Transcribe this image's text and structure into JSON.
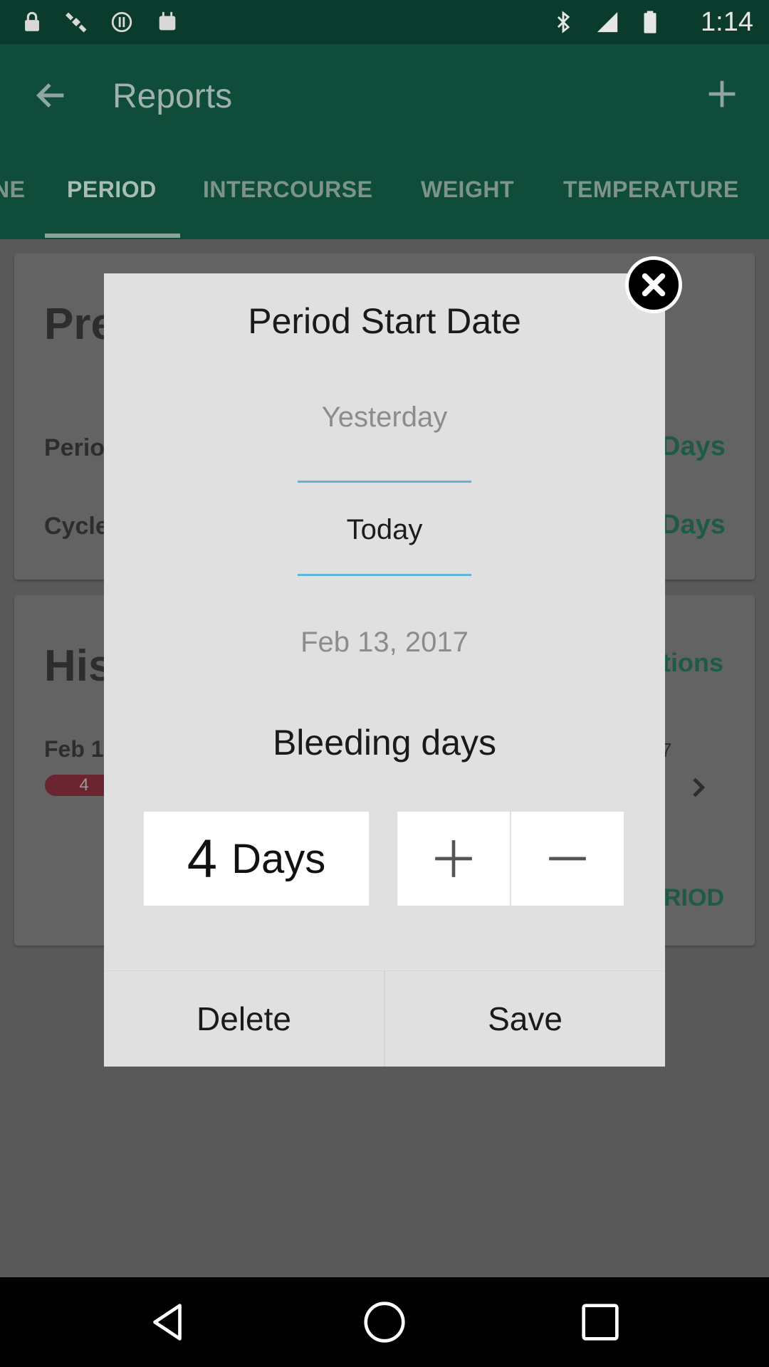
{
  "status_bar": {
    "time": "1:14",
    "icons": [
      "lock-icon",
      "fake-gps-icon",
      "sync-icon",
      "android-icon",
      "bluetooth-icon",
      "signal-icon",
      "battery-icon"
    ]
  },
  "app_bar": {
    "title": "Reports",
    "tabs": [
      {
        "label": "NE",
        "active": false
      },
      {
        "label": "PERIOD",
        "active": true
      },
      {
        "label": "INTERCOURSE",
        "active": false
      },
      {
        "label": "WEIGHT",
        "active": false
      },
      {
        "label": "TEMPERATURE",
        "active": false
      }
    ]
  },
  "background": {
    "card1": {
      "heading": "Pre",
      "row1_label": "Perio",
      "row1_value": "Days",
      "row2_label": "Cycle",
      "row2_value": "Days"
    },
    "card2": {
      "heading": "His",
      "options": "tions",
      "row_date": "Feb 1",
      "row_badge": "4",
      "row_right": "7",
      "action": "RIOD"
    }
  },
  "dialog": {
    "title": "Period Start Date",
    "picker": {
      "above": "Yesterday",
      "selected": "Today",
      "below": "Feb 13, 2017"
    },
    "bleeding_title": "Bleeding days",
    "days_value": "4",
    "days_unit": "Days",
    "delete_label": "Delete",
    "save_label": "Save"
  },
  "colors": {
    "status_bar": "#0a3b2d",
    "app_bar": "#0f4c3a",
    "scrim": "#595959",
    "dialog_bg": "#e0e0e0",
    "picker_line": "#5fb5d7",
    "badge": "#6b2530"
  }
}
